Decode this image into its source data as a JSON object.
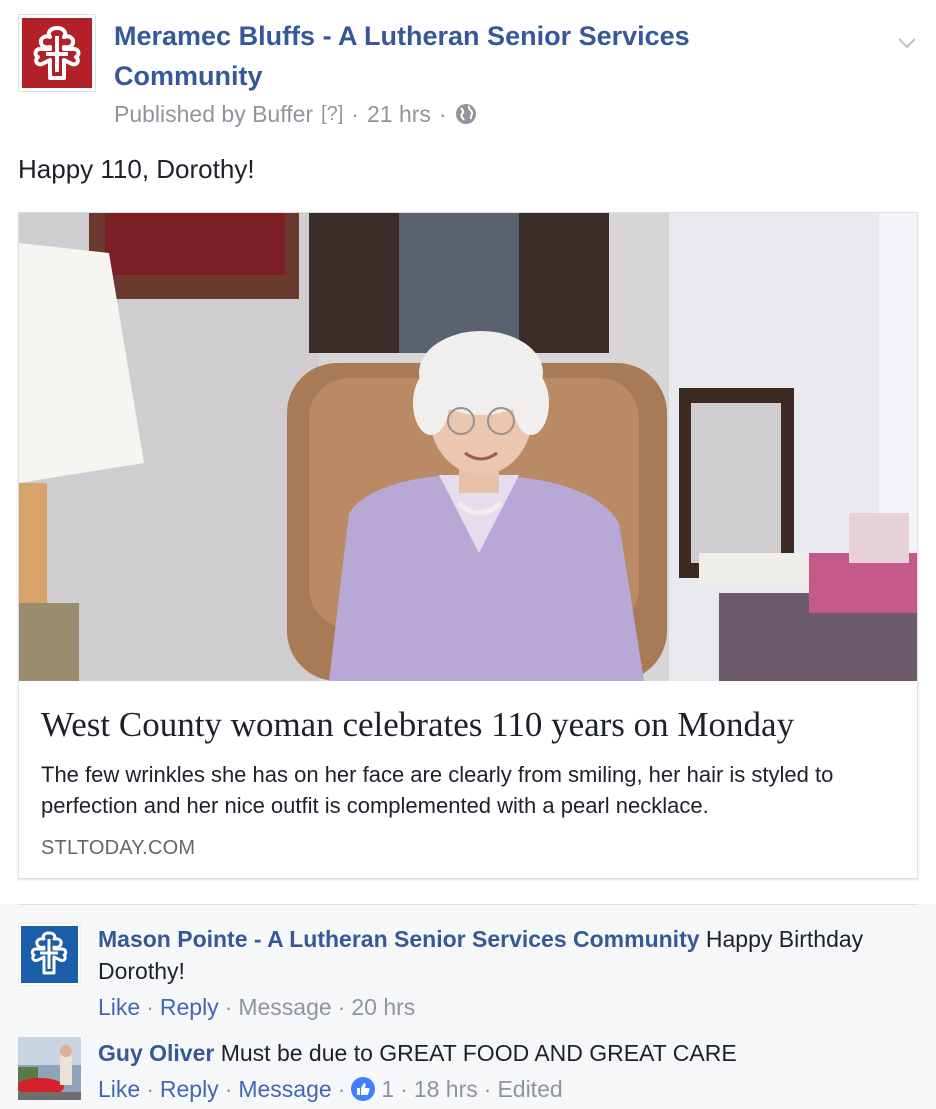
{
  "post": {
    "page_name": "Meramec Bluffs - A Lutheran Senior Services Community",
    "published_by": "Published by Buffer",
    "help_marker": "[?]",
    "time": "21 hrs",
    "text": "Happy 110, Dorothy!",
    "logo_color": "#b22127"
  },
  "link_card": {
    "title": "West County woman celebrates 110 years on Monday",
    "description": "The few wrinkles she has on her face are clearly from smiling, her hair is styled to perfection and her nice outfit is complemented with a pearl necklace.",
    "domain": "STLTODAY.COM"
  },
  "comments": [
    {
      "author": "Mason Pointe - A Lutheran Senior Services Community",
      "text": "Happy Birthday Dorothy!",
      "like_label": "Like",
      "reply_label": "Reply",
      "message_label": "Message",
      "time": "20 hrs",
      "logo_color": "#1a5da8"
    },
    {
      "author": "Guy Oliver",
      "text": "Must be due to GREAT FOOD AND GREAT CARE",
      "like_label": "Like",
      "reply_label": "Reply",
      "message_label": "Message",
      "like_count": "1",
      "time": "18 hrs",
      "edited": "Edited"
    }
  ],
  "colors": {
    "link_blue": "#365899",
    "meta_gray": "#90949c",
    "like_blue": "#4080ff"
  }
}
